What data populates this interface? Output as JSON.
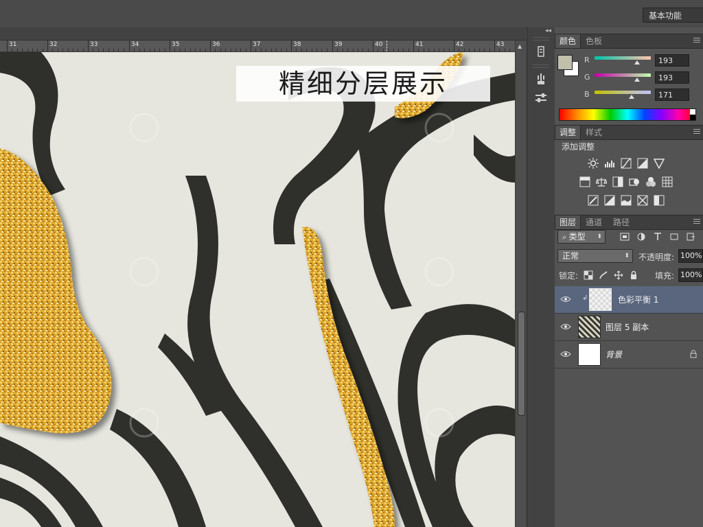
{
  "options_bar": {
    "workspace": "基本功能"
  },
  "ruler": {
    "labels": [
      "31",
      "32",
      "33",
      "34",
      "35",
      "36",
      "37",
      "38",
      "39",
      "40",
      "41",
      "42",
      "43"
    ]
  },
  "canvas": {
    "caption": "精细分层展示"
  },
  "color_panel": {
    "tabs": [
      "颜色",
      "色板"
    ],
    "fg_color": "#c1c1ab",
    "bg_color": "#ffffff",
    "channels": [
      {
        "label": "R",
        "value": "193"
      },
      {
        "label": "G",
        "value": "193"
      },
      {
        "label": "B",
        "value": "171"
      }
    ]
  },
  "adjustments_panel": {
    "tabs": [
      "调整",
      "样式"
    ],
    "title": "添加调整",
    "icons_row1": [
      "brightness-icon",
      "levels-icon",
      "curves-icon",
      "exposure-icon",
      "vibrance-icon"
    ],
    "icons_row2": [
      "hue-saturation-icon",
      "color-balance-icon",
      "black-white-icon",
      "photo-filter-icon",
      "channel-mixer-icon",
      "color-lookup-icon"
    ],
    "icons_row3": [
      "invert-icon",
      "posterize-icon",
      "threshold-icon",
      "selective-color-icon",
      "gradient-map-icon"
    ]
  },
  "layers_panel": {
    "tabs": [
      "图层",
      "通道",
      "路径"
    ],
    "filter_kind": "类型",
    "blend_mode": "正常",
    "opacity_label": "不透明度:",
    "opacity": "100%",
    "lock_label": "锁定:",
    "fill_label": "填充:",
    "fill": "100%",
    "layers": [
      {
        "name": "色彩平衡 1",
        "selected": true
      },
      {
        "name": "图层 5 副本",
        "selected": false
      },
      {
        "name": "背景",
        "selected": false,
        "locked": true
      }
    ]
  }
}
